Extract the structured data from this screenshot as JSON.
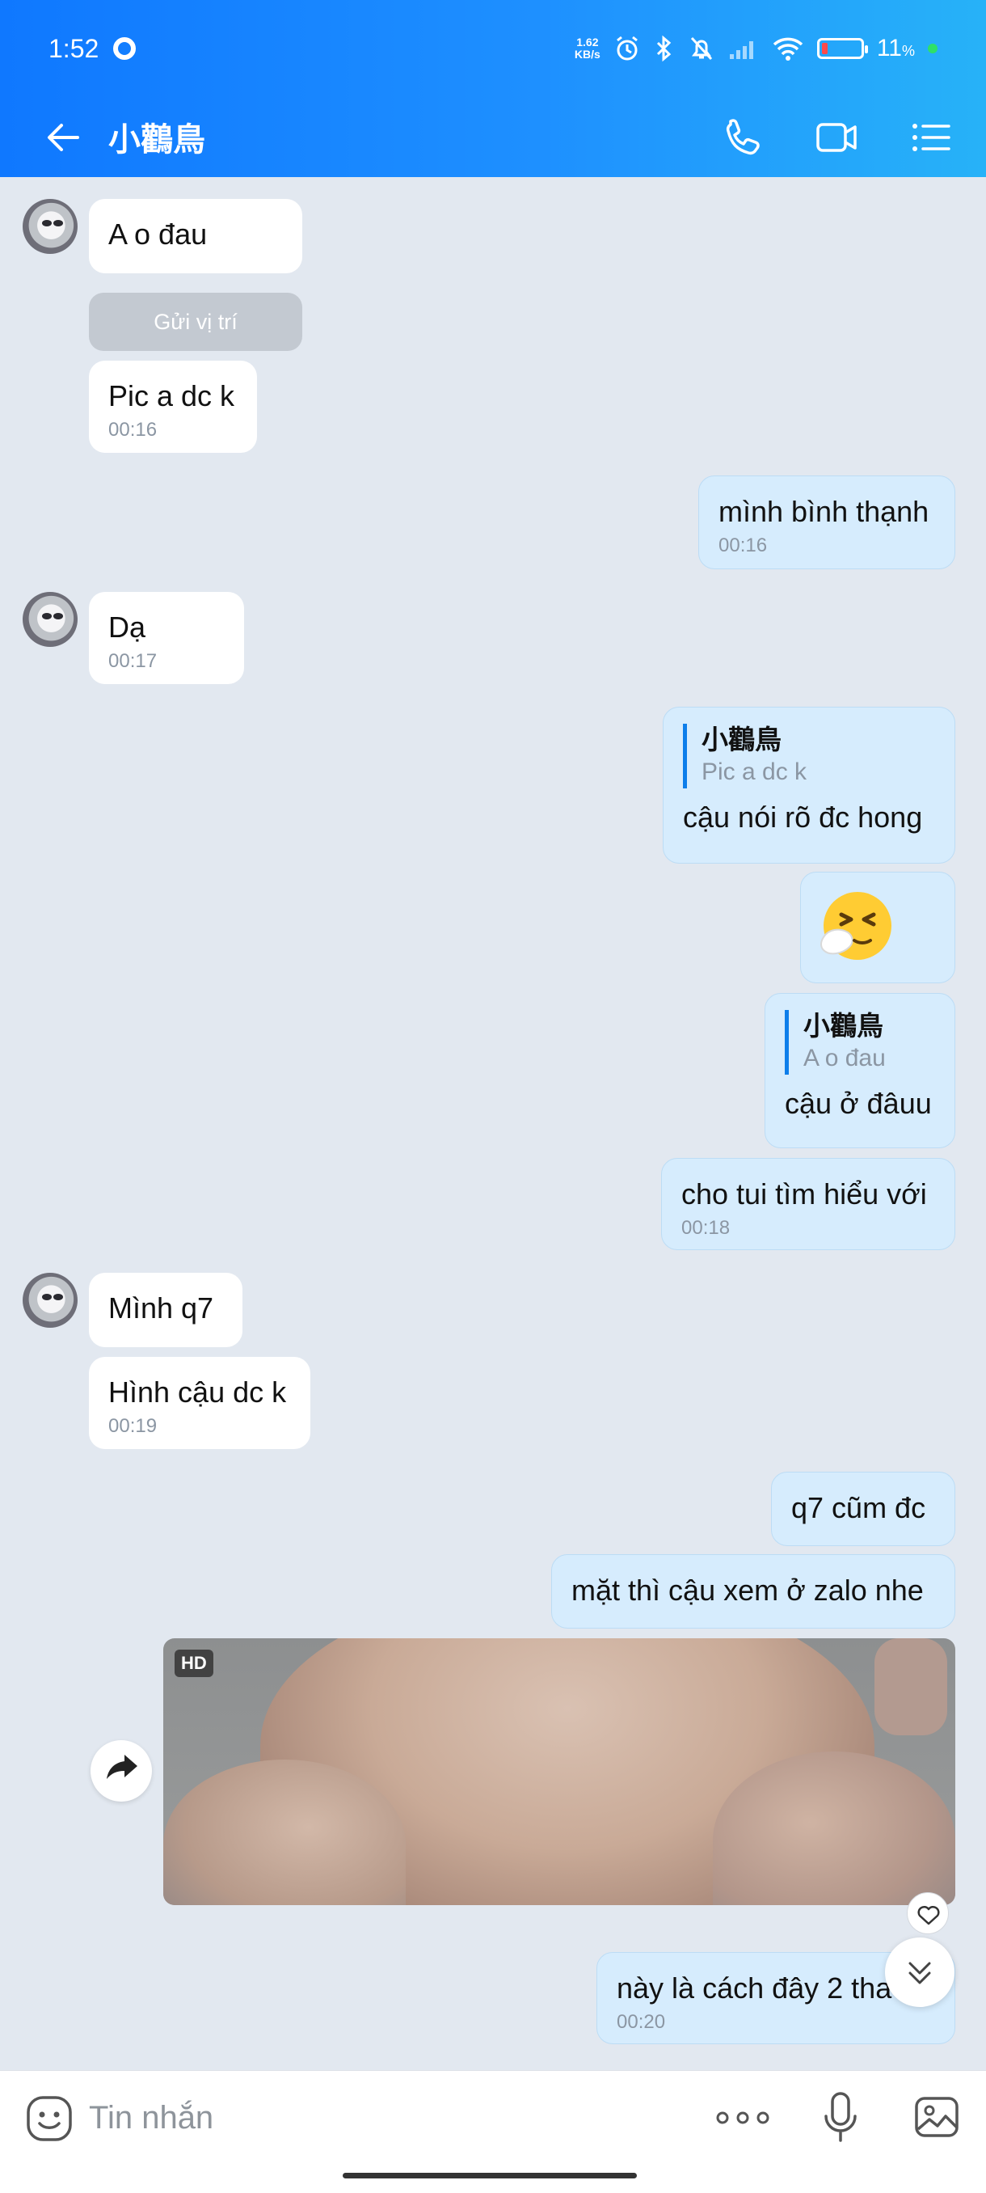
{
  "status_bar": {
    "time": "1:52",
    "net_speed_value": "1.62",
    "net_speed_unit": "KB/s",
    "battery_percent": "11",
    "battery_unit": "%"
  },
  "header": {
    "title": "小鸛鳥",
    "accent_color": "#1e90ff"
  },
  "messages": [
    {
      "id": "m1",
      "side": "in",
      "text": "A o đau"
    },
    {
      "id": "sys",
      "side": "system",
      "text": "Gửi vị trí"
    },
    {
      "id": "m2",
      "side": "in",
      "text": "Pic a dc k",
      "time": "00:16"
    },
    {
      "id": "m3",
      "side": "out",
      "text": "mình bình thạnh",
      "time": "00:16"
    },
    {
      "id": "m4",
      "side": "in",
      "text": "Dạ",
      "time": "00:17"
    },
    {
      "id": "m5",
      "side": "out",
      "quote_name": "小鸛鳥",
      "quote_text": "Pic a dc k",
      "text": "cậu nói rõ đc hong"
    },
    {
      "id": "m6",
      "side": "out",
      "emoji": "sneezing-face",
      "text": "🤧"
    },
    {
      "id": "m7",
      "side": "out",
      "quote_name": "小鸛鳥",
      "quote_text": "A o đau",
      "text": "cậu ở đâuu"
    },
    {
      "id": "m8",
      "side": "out",
      "text": "cho tui tìm hiểu với",
      "time": "00:18"
    },
    {
      "id": "m9",
      "side": "in",
      "text": "Mình q7"
    },
    {
      "id": "m10",
      "side": "in",
      "text": "Hình cậu dc k",
      "time": "00:19"
    },
    {
      "id": "m11",
      "side": "out",
      "text": "q7 cũm đc"
    },
    {
      "id": "m12",
      "side": "out",
      "text": "mặt thì cậu xem ở zalo nhe"
    },
    {
      "id": "m13",
      "side": "out",
      "type": "photo",
      "badge": "HD"
    },
    {
      "id": "m14",
      "side": "out",
      "text": "này là cách đây 2 tha",
      "time": "00:20"
    }
  ],
  "input": {
    "placeholder": "Tin nhắn"
  }
}
